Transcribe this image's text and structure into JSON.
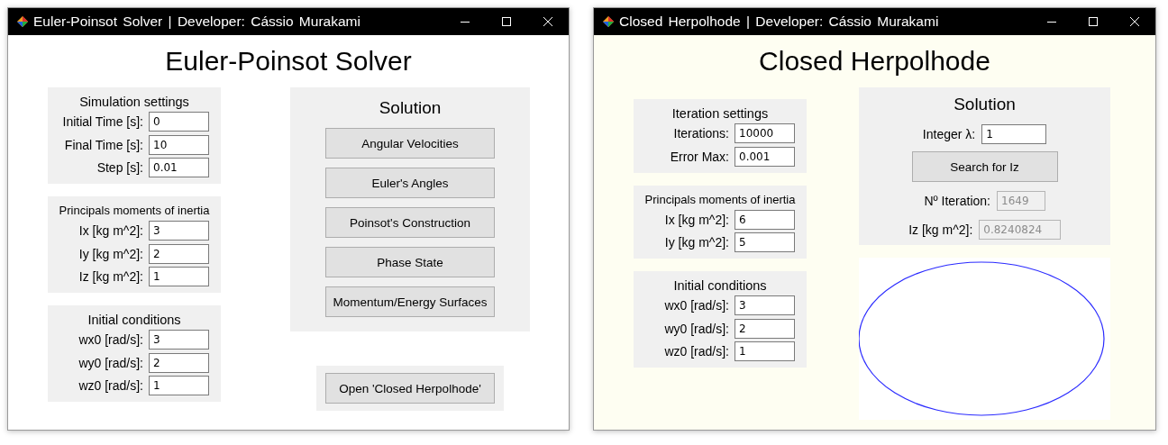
{
  "windows": [
    {
      "kind": "main",
      "title": "Euler-Poinsot Solver | Developer: Cássio Murakami",
      "heading": "Euler-Poinsot Solver",
      "left_panels": [
        {
          "title": "Simulation settings",
          "items": [
            {
              "kind": "field",
              "label": "Initial Time [s]:",
              "value": "0",
              "disabled": false
            },
            {
              "kind": "field",
              "label": "Final Time [s]:",
              "value": "10",
              "disabled": false
            },
            {
              "kind": "field",
              "label": "Step [s]:",
              "value": "0.01",
              "disabled": false
            }
          ]
        },
        {
          "title": "Principals moments of inertia",
          "items": [
            {
              "kind": "field",
              "label": "Ix [kg m^2]:",
              "value": "3",
              "disabled": false
            },
            {
              "kind": "field",
              "label": "Iy [kg m^2]:",
              "value": "2",
              "disabled": false
            },
            {
              "kind": "field",
              "label": "Iz [kg m^2]:",
              "value": "1",
              "disabled": false
            }
          ]
        },
        {
          "title": "Initial conditions",
          "items": [
            {
              "kind": "field",
              "label": "wx0 [rad/s]:",
              "value": "3",
              "disabled": false
            },
            {
              "kind": "field",
              "label": "wy0 [rad/s]:",
              "value": "2",
              "disabled": false
            },
            {
              "kind": "field",
              "label": "wz0 [rad/s]:",
              "value": "1",
              "disabled": false
            }
          ]
        }
      ],
      "right_panels": [
        {
          "kind": "group",
          "title": "Solution",
          "items": [
            {
              "kind": "button",
              "label": "Angular Velocities"
            },
            {
              "kind": "button",
              "label": "Euler's Angles"
            },
            {
              "kind": "button",
              "label": "Poinsot's Construction"
            },
            {
              "kind": "button",
              "label": "Phase State"
            },
            {
              "kind": "button",
              "label": "Momentum/Energy Surfaces"
            }
          ]
        },
        {
          "kind": "group",
          "items": [
            {
              "kind": "button",
              "label": "Open 'Closed Herpolhode'"
            }
          ]
        }
      ]
    },
    {
      "kind": "tool",
      "title": "Closed Herpolhode | Developer: Cássio Murakami",
      "heading": "Closed Herpolhode",
      "left_panels": [
        {
          "title": "Iteration settings",
          "items": [
            {
              "kind": "field",
              "label": "Iterations:",
              "value": "10000",
              "disabled": false
            },
            {
              "kind": "field",
              "label": "Error Max:",
              "value": "0.001",
              "disabled": false
            }
          ]
        },
        {
          "title": "Principals moments of inertia",
          "items": [
            {
              "kind": "field",
              "label": "Ix [kg m^2]:",
              "value": "6",
              "disabled": false
            },
            {
              "kind": "field",
              "label": "Iy [kg m^2]:",
              "value": "5",
              "disabled": false
            }
          ]
        },
        {
          "title": "Initial conditions",
          "items": [
            {
              "kind": "field",
              "label": "wx0 [rad/s]:",
              "value": "3",
              "disabled": false
            },
            {
              "kind": "field",
              "label": "wy0 [rad/s]:",
              "value": "2",
              "disabled": false
            },
            {
              "kind": "field",
              "label": "wz0 [rad/s]:",
              "value": "1",
              "disabled": false
            }
          ]
        }
      ],
      "right_panels": [
        {
          "kind": "group",
          "title": "Solution",
          "items": [
            {
              "kind": "field",
              "label": "Integer λ:",
              "value": "1",
              "disabled": false
            },
            {
              "kind": "button",
              "label": "Search for Iz"
            },
            {
              "kind": "field",
              "label": "Nº Iteration:",
              "value": "1649",
              "disabled": true
            },
            {
              "kind": "field",
              "label": "Iz [kg m^2]:",
              "value": "0.8240824",
              "disabled": true
            }
          ]
        },
        {
          "kind": "plot"
        }
      ]
    }
  ]
}
